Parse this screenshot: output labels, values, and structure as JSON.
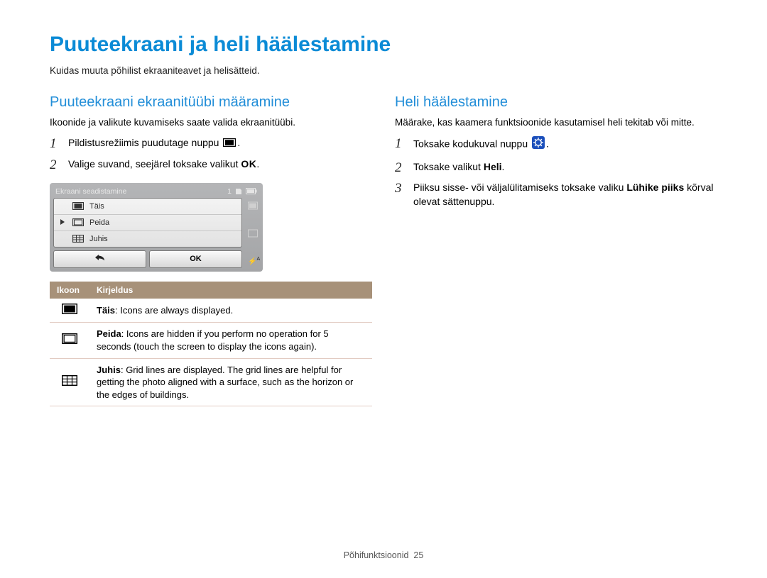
{
  "title": "Puuteekraani ja heli häälestamine",
  "subtitle": "Kuidas muuta põhilist ekraaniteavet ja helisätteid.",
  "left": {
    "heading": "Puuteekraani ekraanitüübi määramine",
    "desc": "Ikoonide ja valikute kuvamiseks saate valida ekraanitüübi.",
    "step1": "Pildistusrežiimis puudutage nuppu ",
    "step1_tail": ".",
    "step2": "Valige suvand, seejärel toksake valikut ",
    "step2_ok": "OK",
    "step2_tail": "."
  },
  "lcd": {
    "title": "Ekraani seadistamine",
    "status_num": "1",
    "items": [
      "Täis",
      "Peida",
      "Juhis"
    ],
    "btn_ok": "OK"
  },
  "table": {
    "h1": "Ikoon",
    "h2": "Kirjeldus",
    "rows": [
      {
        "name": "Täis",
        "desc": ": Icons are always displayed."
      },
      {
        "name": "Peida",
        "desc": ": Icons are hidden if you perform no operation for 5 seconds (touch the screen to display the icons again)."
      },
      {
        "name": "Juhis",
        "desc": ": Grid lines are displayed. The grid lines are helpful for getting the photo aligned with a surface, such as the horizon or the edges of buildings."
      }
    ]
  },
  "right": {
    "heading": "Heli häälestamine",
    "desc": "Määrake, kas kaamera funktsioonide kasutamisel heli tekitab või mitte.",
    "step1": "Toksake kodukuval nuppu ",
    "step1_tail": ".",
    "step2_a": "Toksake valikut ",
    "step2_b": "Heli",
    "step2_tail": ".",
    "step3_a": "Piiksu sisse- või väljalülitamiseks toksake valiku ",
    "step3_b": "Lühike piiks",
    "step3_c": " kõrval olevat sättenuppu."
  },
  "footer": {
    "label": "Põhifunktsioonid",
    "page": "25"
  },
  "icons": {
    "fullscreen": "fullscreen-icon",
    "empty": "empty-rect-icon",
    "grid": "grid-icon",
    "back": "back-icon",
    "settings": "settings-icon"
  }
}
